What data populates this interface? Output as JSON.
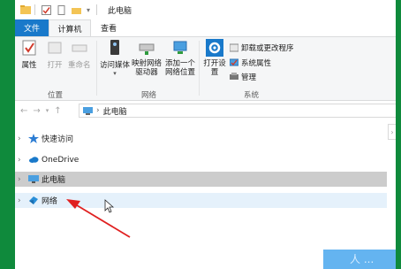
{
  "window": {
    "title": "此电脑"
  },
  "tabs": {
    "file": "文件",
    "computer": "计算机",
    "view": "查看"
  },
  "ribbon": {
    "location": {
      "group": "位置",
      "properties": "属性",
      "open": "打开",
      "rename": "重命名"
    },
    "network": {
      "group": "网络",
      "access_media": "访问媒体",
      "map_drive": "映射网络驱动器",
      "add_location": "添加一个网络位置"
    },
    "system": {
      "group": "系统",
      "open_settings": "打开设置",
      "uninstall": "卸载或更改程序",
      "sys_props": "系统属性",
      "manage": "管理"
    }
  },
  "address": {
    "path": "此电脑"
  },
  "tree": [
    {
      "label": "快速访问",
      "icon": "star-icon"
    },
    {
      "label": "OneDrive",
      "icon": "cloud-icon"
    },
    {
      "label": "此电脑",
      "icon": "computer-icon",
      "selected": true
    },
    {
      "label": "网络",
      "icon": "network-icon",
      "hover": true
    }
  ],
  "overlay": {
    "corner_text": "人 ..."
  },
  "colors": {
    "accent": "#1979ca",
    "annotation_arrow": "#e02020",
    "frame": "#0f8a3c"
  }
}
